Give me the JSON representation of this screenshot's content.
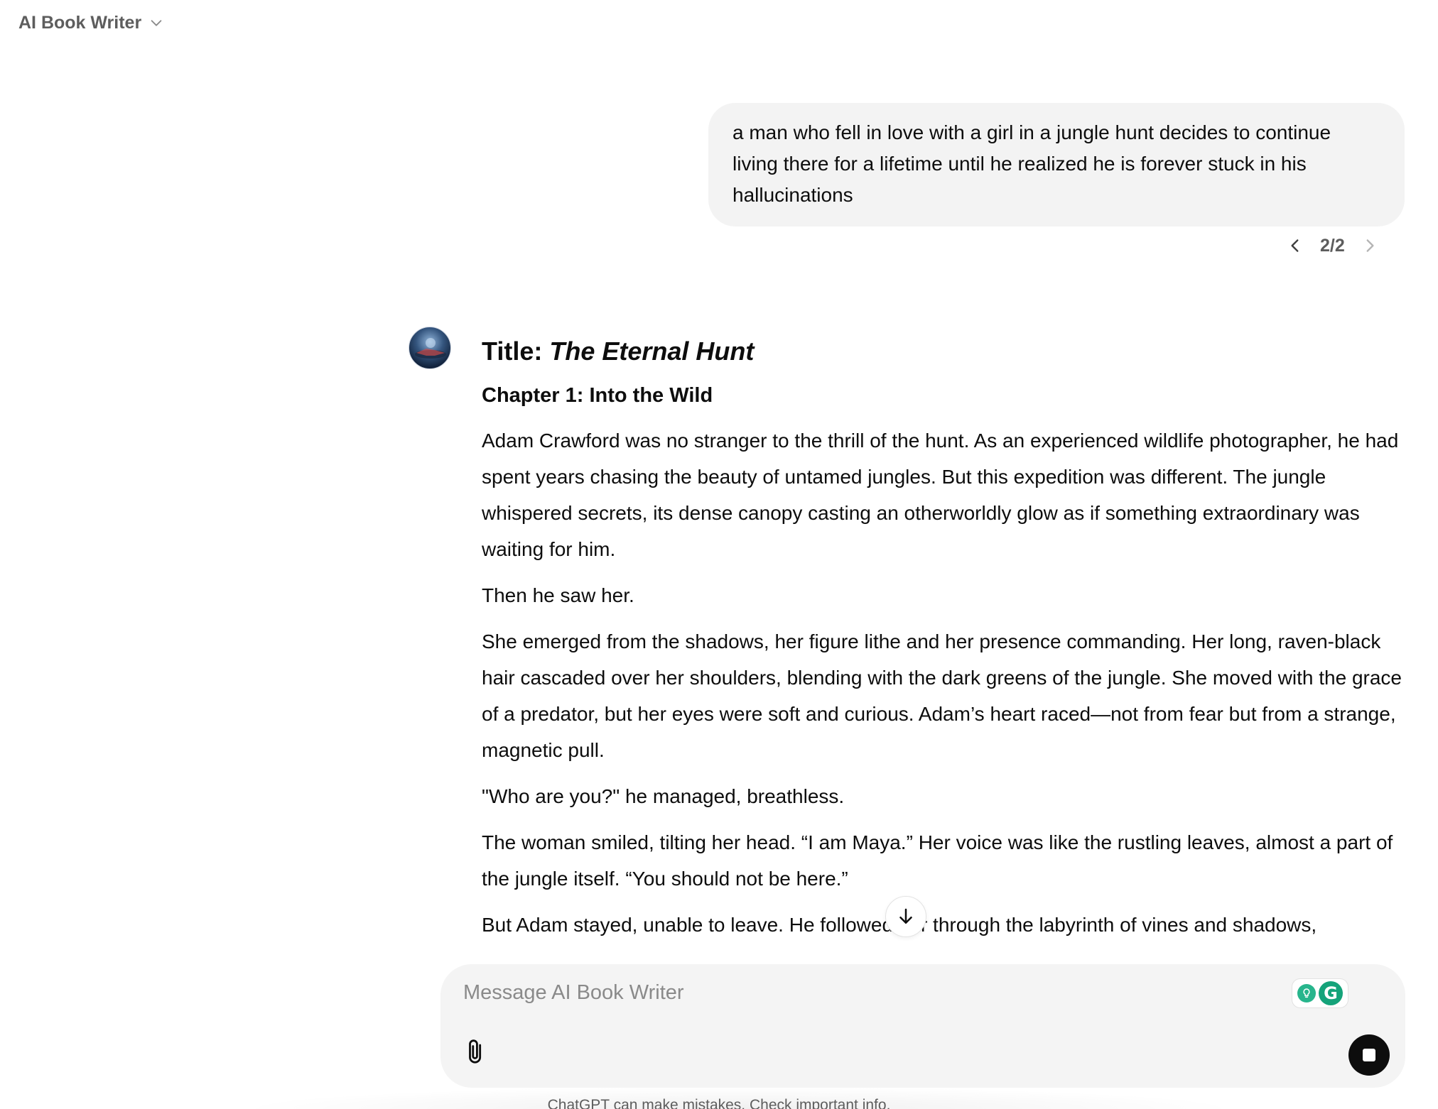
{
  "header": {
    "title": "AI Book Writer"
  },
  "user_message": {
    "text": "a man who fell in love with a girl in a jungle hunt decides to continue living there for a lifetime until he realized he is forever stuck in his hallucinations",
    "pager": "2/2"
  },
  "response": {
    "title_prefix": "Title: ",
    "title_italic": "The Eternal Hunt",
    "chapter": "Chapter 1: Into the Wild",
    "paragraphs": [
      "Adam Crawford was no stranger to the thrill of the hunt. As an experienced wildlife photographer, he had spent years chasing the beauty of untamed jungles. But this expedition was different. The jungle whispered secrets, its dense canopy casting an otherworldly glow as if something extraordinary was waiting for him.",
      "Then he saw her.",
      "She emerged from the shadows, her figure lithe and her presence commanding. Her long, raven-black hair cascaded over her shoulders, blending with the dark greens of the jungle. She moved with the grace of a predator, but her eyes were soft and curious. Adam’s heart raced—not from fear but from a strange, magnetic pull.",
      "\"Who are you?\" he managed, breathless.",
      "The woman smiled, tilting her head. “I am Maya.” Her voice was like the rustling leaves, almost a part of the jungle itself. “You should not be here.”",
      "But Adam stayed, unable to leave. He followed her through the labyrinth of vines and shadows,"
    ]
  },
  "composer": {
    "placeholder": "Message AI Book Writer",
    "grammarly_letter": "G"
  },
  "disclaimer": "ChatGPT can make mistakes. Check important info.",
  "icons": {
    "header_chevron": "chevron-down-icon",
    "prev": "chevron-left-icon",
    "next": "chevron-right-icon",
    "scroll": "arrow-down-icon",
    "attach": "paperclip-icon",
    "stop": "stop-icon"
  }
}
